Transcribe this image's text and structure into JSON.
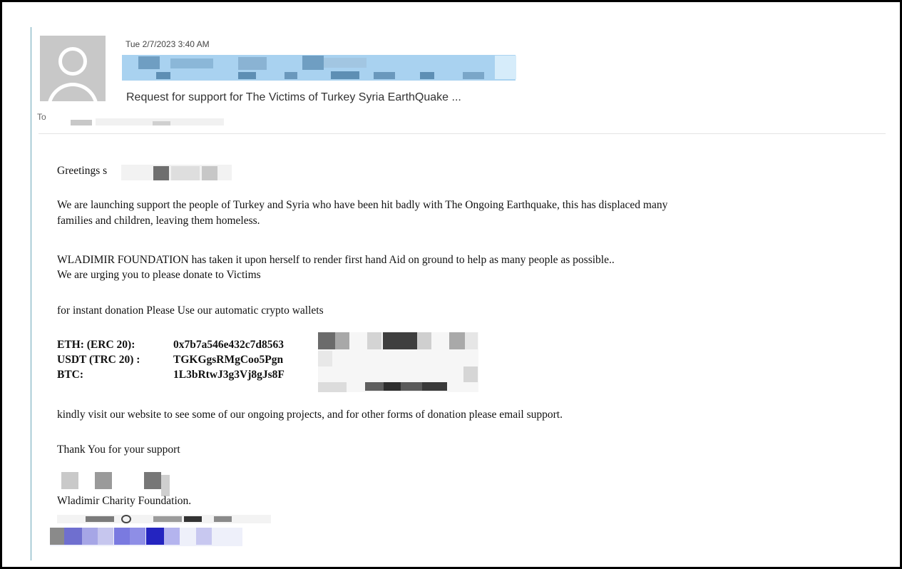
{
  "header": {
    "date": "Tue 2/7/2023 3:40 AM",
    "subject": "Request for support for The Victims of Turkey Syria EarthQuake ...",
    "to_label": "To"
  },
  "message": {
    "greeting": "Greetings s",
    "para1_line1": "We are launching support the people of Turkey and Syria who have been hit badly with The Ongoing Earthquake, this has displaced many",
    "para1_line2": "families and children, leaving them homeless.",
    "para2_line1": "WLADIMIR FOUNDATION has taken it upon herself to render first hand Aid on ground to help as many people as possible..",
    "para2_line2": "We are urging you to please donate to Victims",
    "para3": "for instant donation Please Use our automatic crypto wallets",
    "wallets": [
      {
        "label": "ETH: (ERC 20):",
        "address": "0x7b7a546e432c7d8563"
      },
      {
        "label": "USDT (TRC 20) :",
        "address": "TGKGgsRMgCoo5Pgn"
      },
      {
        "label": "BTC:",
        "address": "1L3bRtwJ3g3Vj8gJs8F"
      }
    ],
    "para4": "kindly visit our website to see some of our ongoing projects, and for other forms of donation please email support.",
    "thanks": "Thank You for your support",
    "signature": "Wladimir Charity Foundation."
  }
}
